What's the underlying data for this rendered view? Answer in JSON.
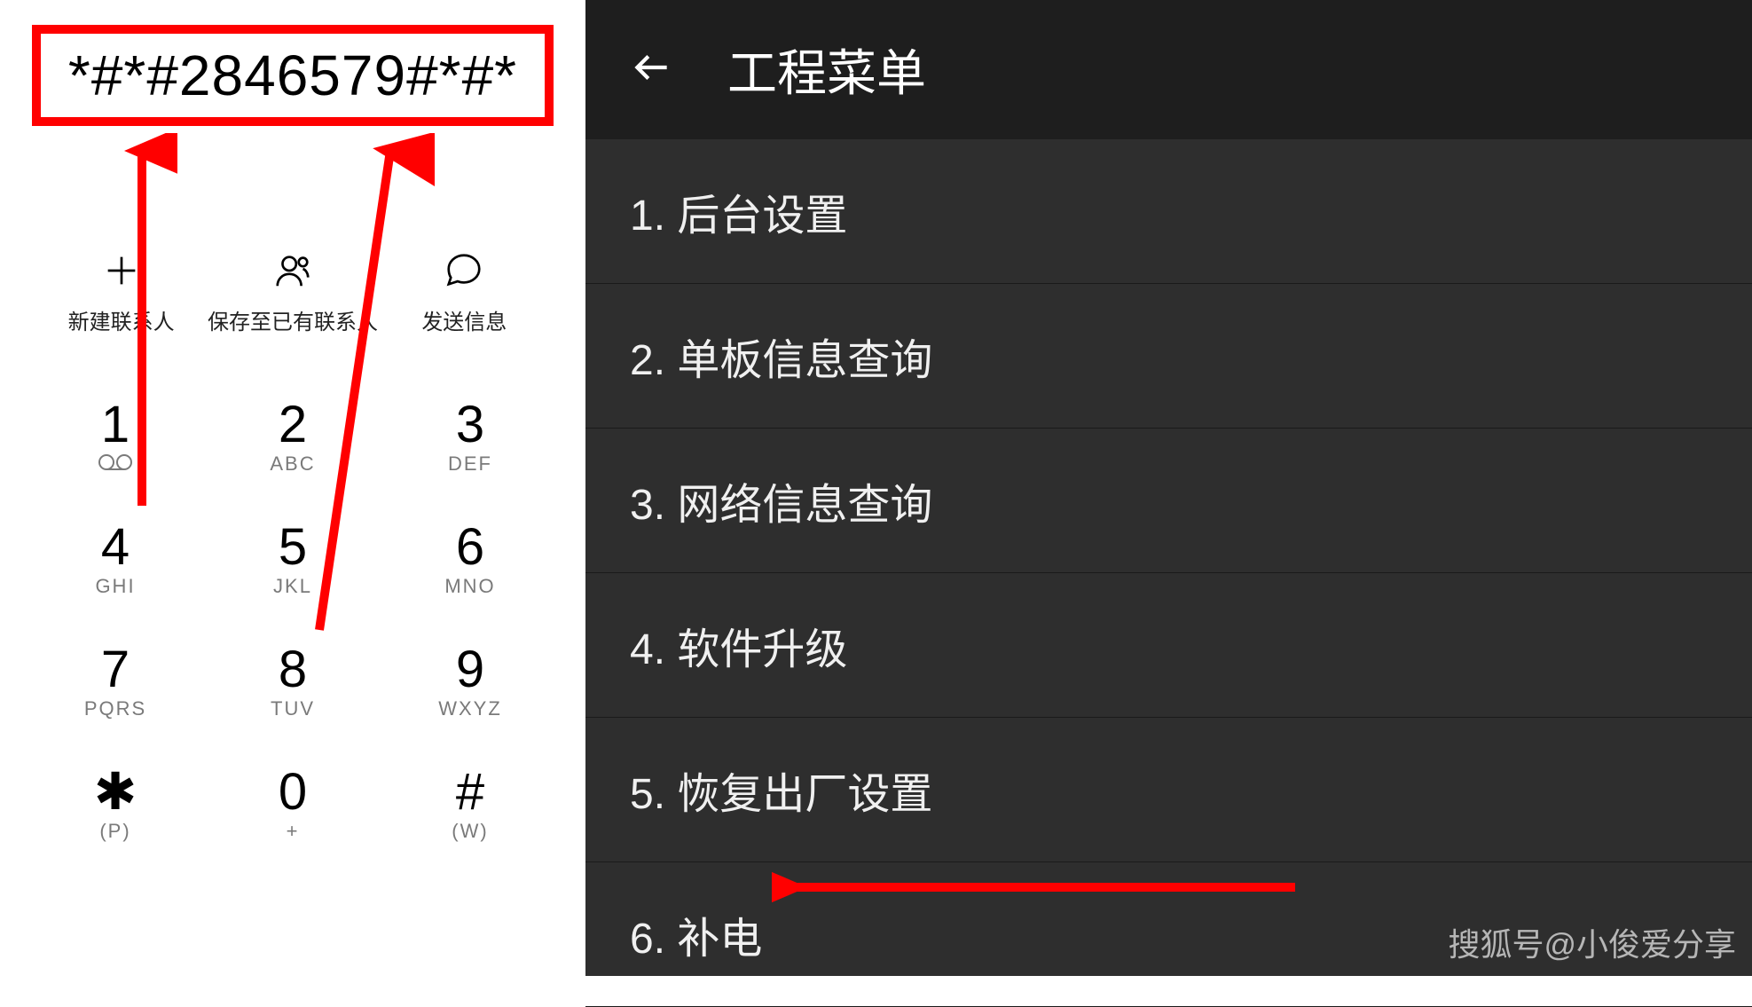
{
  "dialer": {
    "code": "*#*#2846579#*#*",
    "actions": [
      {
        "name": "new-contact",
        "label": "新建联系人",
        "icon": "plus-icon"
      },
      {
        "name": "save-contact",
        "label": "保存至已有联系人",
        "icon": "person-icon"
      },
      {
        "name": "send-message",
        "label": "发送信息",
        "icon": "chat-icon"
      }
    ],
    "keys": [
      {
        "digit": "1",
        "sub": "",
        "sub_icon": "voicemail-icon"
      },
      {
        "digit": "2",
        "sub": "ABC"
      },
      {
        "digit": "3",
        "sub": "DEF"
      },
      {
        "digit": "4",
        "sub": "GHI"
      },
      {
        "digit": "5",
        "sub": "JKL"
      },
      {
        "digit": "6",
        "sub": "MNO"
      },
      {
        "digit": "7",
        "sub": "PQRS"
      },
      {
        "digit": "8",
        "sub": "TUV"
      },
      {
        "digit": "9",
        "sub": "WXYZ"
      },
      {
        "digit": "✱",
        "sub": "(P)"
      },
      {
        "digit": "0",
        "sub": "+"
      },
      {
        "digit": "#",
        "sub": "(W)"
      }
    ]
  },
  "menu": {
    "title": "工程菜单",
    "items": [
      "1. 后台设置",
      "2. 单板信息查询",
      "3. 网络信息查询",
      "4. 软件升级",
      "5. 恢复出厂设置",
      "6. 补电"
    ]
  },
  "watermark": "搜狐号@小俊爱分享",
  "annotation_color": "#ff0000"
}
